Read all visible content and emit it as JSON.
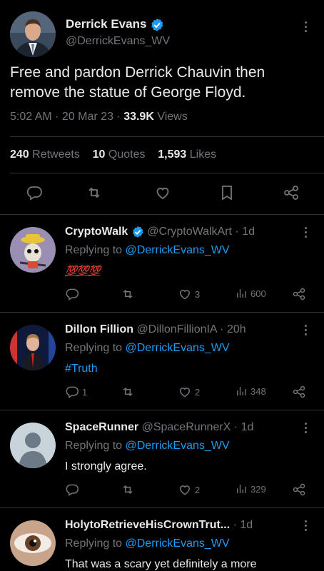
{
  "main_tweet": {
    "author_name": "Derrick Evans",
    "handle": "@DerrickEvans_WV",
    "text": "Free and pardon Derrick Chauvin then remove the statue of George Floyd.",
    "time": "5:02 AM",
    "date": "20 Mar 23",
    "views_count": "33.9K",
    "views_label": "Views",
    "retweets_count": "240",
    "retweets_label": "Retweets",
    "quotes_count": "10",
    "quotes_label": "Quotes",
    "likes_count": "1,593",
    "likes_label": "Likes"
  },
  "replies": [
    {
      "name": "CryptoWalk",
      "verified": true,
      "handle": "@CryptoWalkArt",
      "time": "1d",
      "replying_prefix": "Replying to",
      "replying_to": "@DerrickEvans_WV",
      "text": "💯💯💯",
      "reply_count": "",
      "like_count": "3",
      "view_count": "600"
    },
    {
      "name": "Dillon Fillion",
      "verified": false,
      "handle": "@DillonFillionIA",
      "time": "20h",
      "replying_prefix": "Replying to",
      "replying_to": "@DerrickEvans_WV",
      "text": "#Truth",
      "reply_count": "1",
      "like_count": "2",
      "view_count": "348"
    },
    {
      "name": "SpaceRunner",
      "verified": false,
      "handle": "@SpaceRunnerX",
      "time": "1d",
      "replying_prefix": "Replying to",
      "replying_to": "@DerrickEvans_WV",
      "text": "I strongly agree.",
      "reply_count": "",
      "like_count": "2",
      "view_count": "329"
    },
    {
      "name": "HolytoRetrieveHisCrownTrut...",
      "verified": false,
      "handle": "",
      "time": "1d",
      "replying_prefix": "Replying to",
      "replying_to": "@DerrickEvans_WV",
      "text": "That was a scary yet definitely a more",
      "reply_count": "",
      "like_count": "",
      "view_count": ""
    }
  ],
  "colors": {
    "background": "#000000",
    "accent": "#1d9bf0",
    "secondary_text": "#71767b",
    "divider": "#2f3336"
  },
  "icons": [
    "verified-badge-icon",
    "more-icon",
    "reply-icon",
    "retweet-icon",
    "like-icon",
    "bookmark-icon",
    "share-icon",
    "views-icon"
  ]
}
